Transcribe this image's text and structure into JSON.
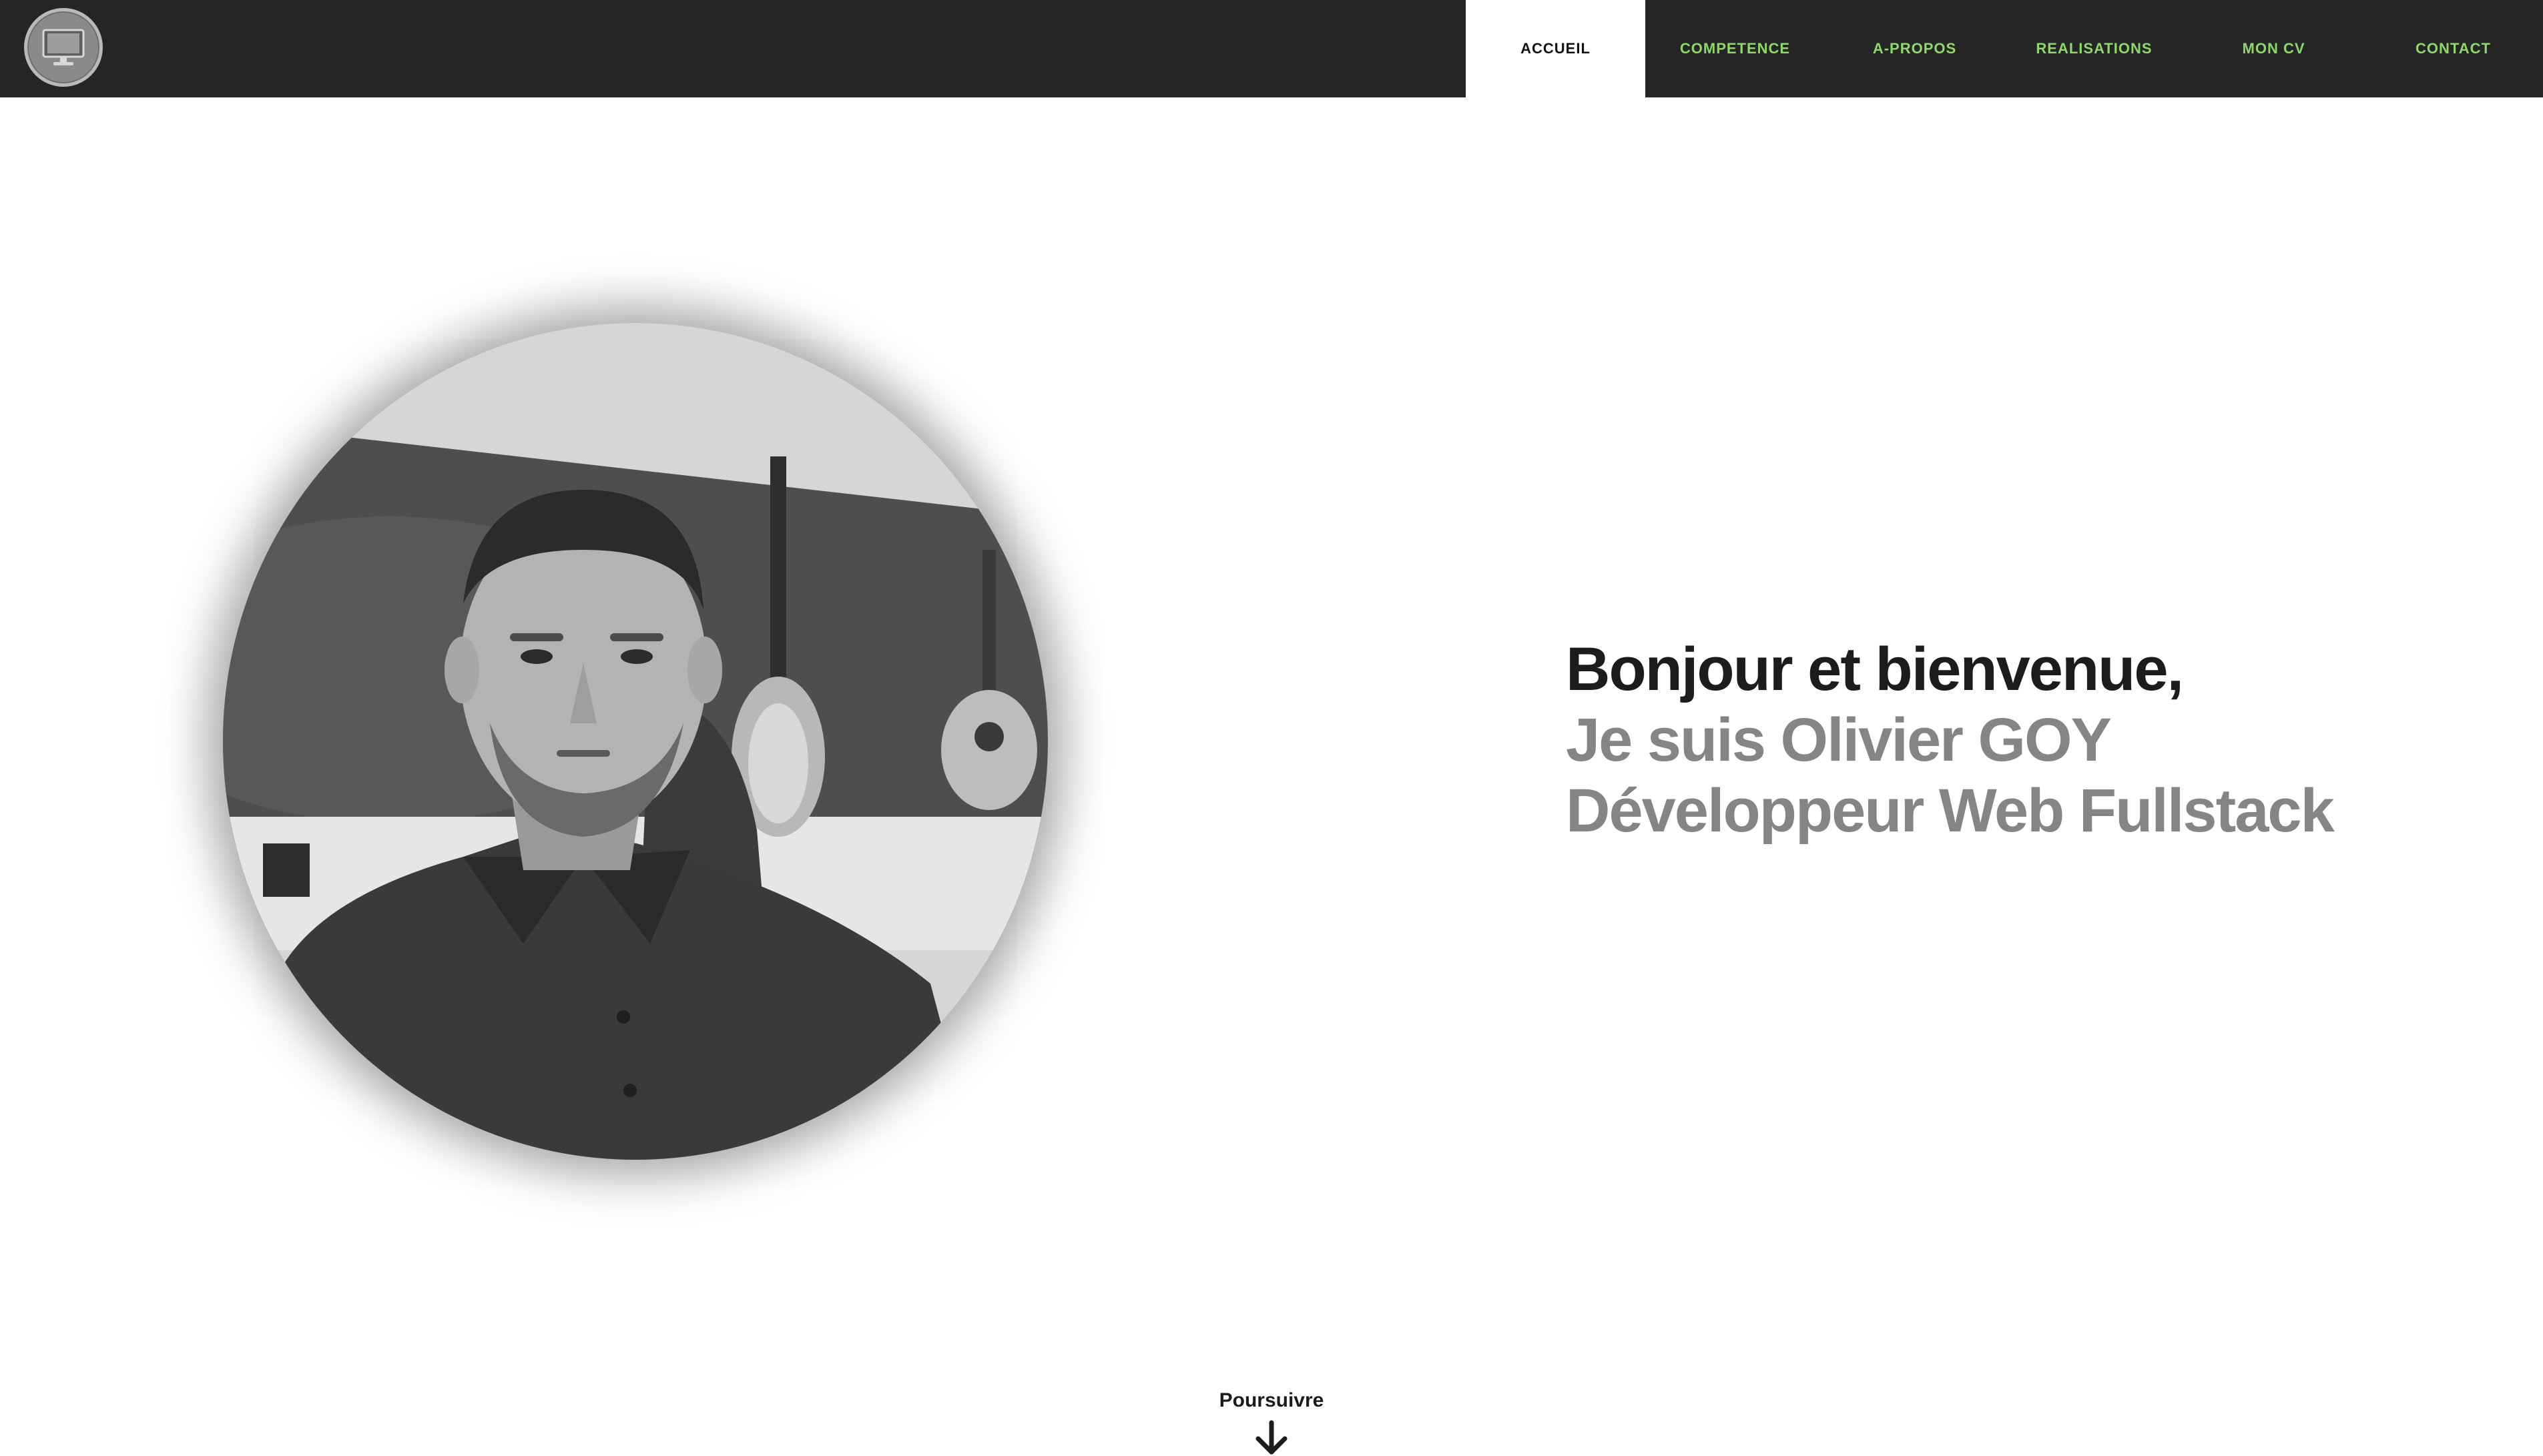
{
  "header": {
    "logo_icon": "monitor-icon",
    "nav": [
      {
        "label": "ACCUEIL",
        "active": true
      },
      {
        "label": "COMPETENCE",
        "active": false
      },
      {
        "label": "A-PROPOS",
        "active": false
      },
      {
        "label": "REALISATIONS",
        "active": false
      },
      {
        "label": "MON CV",
        "active": false
      },
      {
        "label": "CONTACT",
        "active": false
      }
    ],
    "colors": {
      "bar": "#252525",
      "link": "#8ed86a",
      "active_bg": "#ffffff"
    }
  },
  "hero": {
    "greeting": "Bonjour et bienvenue,",
    "name_line": "Je suis Olivier GOY",
    "role_line": "Développeur Web Fullstack"
  },
  "footer": {
    "continue_label": "Poursuivre",
    "continue_icon": "arrow-down-icon"
  }
}
